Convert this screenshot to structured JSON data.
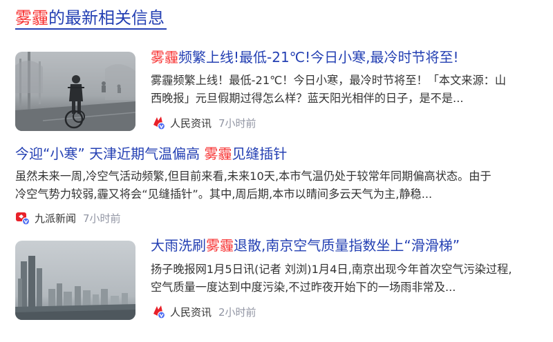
{
  "section": {
    "title_hl": "雾霾",
    "title_rest": "的最新相关信息"
  },
  "colors": {
    "link": "#2440b3",
    "highlight": "#f73131",
    "text": "#333333",
    "meta": "#9195a3",
    "verified_badge": "#4e6ef2"
  },
  "items": [
    {
      "title_hl": "雾霾",
      "title_rest": "频繁上线!最低-21℃!今日小寒,最冷时节将至!",
      "snippet": [
        "雾霾频繁上线！最低-21℃！今日小寒，最冷时节将至！「本文来源：山",
        "西晚报」元旦假期过得怎么样？蓝天阳光相伴的日子，是不是..."
      ],
      "source": "人民资讯",
      "time": "7小时前",
      "icon": "people-news-logo-icon",
      "thumbnail": "smog-cyclist-photo"
    },
    {
      "title_pre": "今迎“小寒” 天津近期气温偏高 ",
      "title_hl": "雾霾",
      "title_rest": "见缝插针",
      "snippet": [
        "虽然未来一周,冷空气活动频繁,但目前来看,未来10天,本市气温仍处于较常年同期偏高状态。由于",
        "冷空气势力较弱,霾又将会“见缝插针”。其中,周后期,本市以晴间多云天气为主,静稳..."
      ],
      "source": "九派新闻",
      "time": "7小时前",
      "icon": "jiupai-news-logo-icon"
    },
    {
      "title_pre": "大雨洗刷",
      "title_hl": "雾霾",
      "title_rest": "退散,南京空气质量指数坐上“滑滑梯”",
      "snippet": [
        "扬子晚报网1月5日讯(记者 刘浏)1月4日,南京出现今年首次空气污染过程,",
        "空气质量一度达到中度污染,不过昨夜开始下的一场雨非常及..."
      ],
      "source": "人民资讯",
      "time": "2小时前",
      "icon": "people-news-logo-icon",
      "thumbnail": "hazy-city-skyline-photo"
    }
  ]
}
